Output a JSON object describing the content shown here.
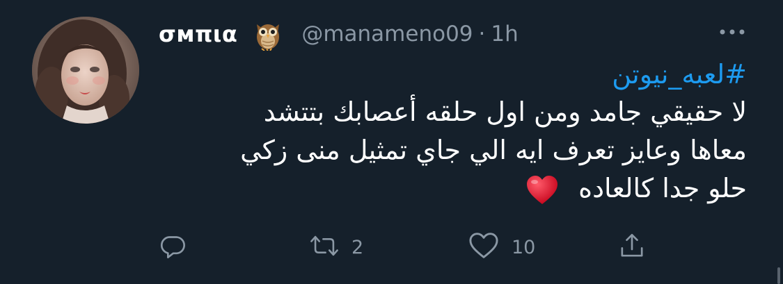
{
  "tweet": {
    "display_name": "σмπια",
    "name_emoji_icon": "owl-icon",
    "handle": "@manameno09",
    "separator": "·",
    "time": "1h",
    "more_icon": "more-horizontal-icon",
    "hashtag": "#لعبه_نيوتن",
    "lines": [
      "لا حقيقي جامد ومن اول حلقه أعصابك بتتشد",
      "معاها وعايز تعرف ايه الي جاي تمثيل منى زكي",
      "حلو جدا كالعاده"
    ],
    "text_emoji_icon": "red-heart-icon"
  },
  "actions": {
    "reply_icon": "reply-icon",
    "retweet_icon": "retweet-icon",
    "retweet_count": "2",
    "like_icon": "heart-outline-icon",
    "like_count": "10",
    "share_icon": "share-icon"
  },
  "colors": {
    "background": "#15202b",
    "primary_text": "#ffffff",
    "secondary_text": "#8b98a5",
    "hashtag": "#1d9bf0",
    "emoji_heart": "#e3112a"
  }
}
